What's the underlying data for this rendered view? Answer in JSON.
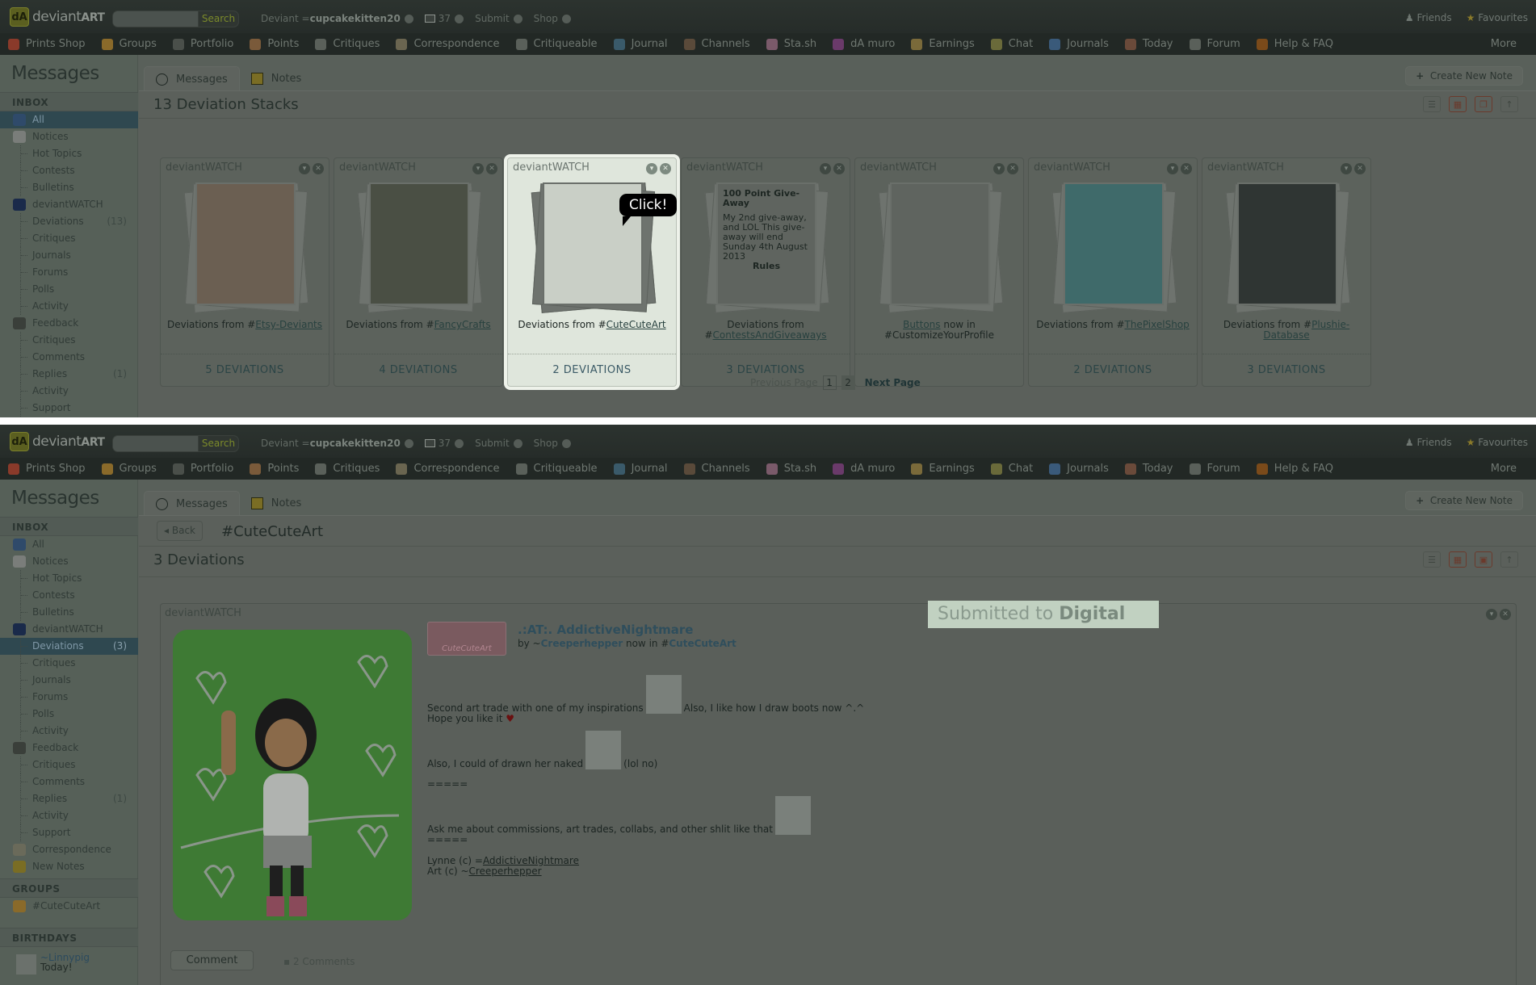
{
  "header": {
    "logo_text": "deviant",
    "logo_bold": "ART",
    "search_placeholder": "",
    "search_button": "Search",
    "user_prefix": "Deviant =",
    "username": "cupcakekitten20",
    "message_count": "37",
    "submit": "Submit",
    "shop": "Shop",
    "friends": "Friends",
    "favourites": "Favourites"
  },
  "nav": {
    "items": [
      {
        "label": "Prints Shop",
        "color": "#8a3a2a"
      },
      {
        "label": "Groups",
        "color": "#8a6a2a"
      },
      {
        "label": "Portfolio",
        "color": "#4a4f4a"
      },
      {
        "label": "Points",
        "color": "#7a5a3a"
      },
      {
        "label": "Critiques",
        "color": "#5a605a"
      },
      {
        "label": "Correspondence",
        "color": "#6a6550"
      },
      {
        "label": "Critiqueable",
        "color": "#5a605a"
      },
      {
        "label": "Journal",
        "color": "#3a5a6a"
      },
      {
        "label": "Channels",
        "color": "#5a4a3a"
      },
      {
        "label": "Sta.sh",
        "color": "#7a5a6a"
      },
      {
        "label": "dA muro",
        "color": "#6a3a6a"
      },
      {
        "label": "Earnings",
        "color": "#7a6a3a"
      },
      {
        "label": "Chat",
        "color": "#6a6a3a"
      },
      {
        "label": "Journals",
        "color": "#3a5a7a"
      },
      {
        "label": "Today",
        "color": "#6a4a3a"
      },
      {
        "label": "Forum",
        "color": "#5a605a"
      },
      {
        "label": "Help & FAQ",
        "color": "#7a4a1a"
      }
    ],
    "more": "More"
  },
  "sidebar": {
    "title": "Messages",
    "inbox_label": "INBOX",
    "groups_label": "GROUPS",
    "birthdays_label": "BIRTHDAYS",
    "screen1_items": [
      {
        "label": "All",
        "type": "top",
        "icon": "mailbox-icon",
        "active": true
      },
      {
        "label": "Notices",
        "type": "top",
        "icon": "notice-icon"
      },
      {
        "label": "Hot Topics",
        "type": "sub"
      },
      {
        "label": "Contests",
        "type": "sub"
      },
      {
        "label": "Bulletins",
        "type": "sub"
      },
      {
        "label": "deviantWATCH",
        "type": "top",
        "icon": "binoculars-icon"
      },
      {
        "label": "Deviations",
        "type": "sub",
        "count": "(13)"
      },
      {
        "label": "Critiques",
        "type": "sub"
      },
      {
        "label": "Journals",
        "type": "sub"
      },
      {
        "label": "Forums",
        "type": "sub"
      },
      {
        "label": "Polls",
        "type": "sub"
      },
      {
        "label": "Activity",
        "type": "sub"
      },
      {
        "label": "Feedback",
        "type": "top",
        "icon": "speech-bubble-icon"
      },
      {
        "label": "Critiques",
        "type": "sub"
      },
      {
        "label": "Comments",
        "type": "sub"
      },
      {
        "label": "Replies",
        "type": "sub",
        "count": "(1)"
      },
      {
        "label": "Activity",
        "type": "sub"
      },
      {
        "label": "Support",
        "type": "sub"
      }
    ],
    "screen2_items": [
      {
        "label": "All",
        "type": "top",
        "icon": "mailbox-icon"
      },
      {
        "label": "Notices",
        "type": "top",
        "icon": "notice-icon"
      },
      {
        "label": "Hot Topics",
        "type": "sub"
      },
      {
        "label": "Contests",
        "type": "sub"
      },
      {
        "label": "Bulletins",
        "type": "sub"
      },
      {
        "label": "deviantWATCH",
        "type": "top",
        "icon": "binoculars-icon"
      },
      {
        "label": "Deviations",
        "type": "sub",
        "count": "(3)",
        "active": true
      },
      {
        "label": "Critiques",
        "type": "sub"
      },
      {
        "label": "Journals",
        "type": "sub"
      },
      {
        "label": "Forums",
        "type": "sub"
      },
      {
        "label": "Polls",
        "type": "sub"
      },
      {
        "label": "Activity",
        "type": "sub"
      },
      {
        "label": "Feedback",
        "type": "top",
        "icon": "speech-bubble-icon"
      },
      {
        "label": "Critiques",
        "type": "sub"
      },
      {
        "label": "Comments",
        "type": "sub"
      },
      {
        "label": "Replies",
        "type": "sub",
        "count": "(1)"
      },
      {
        "label": "Activity",
        "type": "sub"
      },
      {
        "label": "Support",
        "type": "sub"
      },
      {
        "label": "Correspondence",
        "type": "top",
        "icon": "envelope-icon"
      },
      {
        "label": "New Notes",
        "type": "top",
        "icon": "note-icon"
      }
    ],
    "groups": [
      {
        "label": "#CuteCuteArt",
        "icon": "house-icon"
      }
    ],
    "birthdays": [
      {
        "name": "~Linnypig",
        "when": "Today!"
      }
    ]
  },
  "tabs": {
    "messages": "Messages",
    "notes": "Notes",
    "create_note": "Create New Note"
  },
  "stacks": {
    "title": "13 Deviation Stacks",
    "cards": [
      {
        "header": "deviantWATCH",
        "prefix": "Deviations from #",
        "link": "Etsy-Deviants",
        "suffix": "",
        "count": "5 DEVIATIONS",
        "color": "#6b5f52"
      },
      {
        "header": "deviantWATCH",
        "prefix": "Deviations from #",
        "link": "FancyCrafts",
        "suffix": "",
        "count": "4 DEVIATIONS",
        "color": "#4a4f44"
      },
      {
        "header": "deviantWATCH",
        "prefix": "Deviations from #",
        "link": "CuteCuteArt",
        "suffix": "",
        "count": "2 DEVIATIONS",
        "color": "#c9cfc6",
        "highlight": true
      },
      {
        "header": "deviantWATCH",
        "prefix": "Deviations from #",
        "link": "ContestsAndGiveaways",
        "suffix": "",
        "count": "3 DEVIATIONS",
        "color": "#5f645f",
        "journal": {
          "title": "100 Point Give-Away",
          "text": "My 2nd give-away, and LOL This give-away will end Sunday 4th August 2013",
          "footer": "Rules"
        }
      },
      {
        "header": "deviantWATCH",
        "prefix": "",
        "link": "Buttons",
        "suffix": " now in #CustomizeYourProfile",
        "count": "",
        "color": "#5f645f"
      },
      {
        "header": "deviantWATCH",
        "prefix": "Deviations from #",
        "link": "ThePixelShop",
        "suffix": "",
        "count": "2 DEVIATIONS",
        "color": "#3f6a6a"
      },
      {
        "header": "deviantWATCH",
        "prefix": "Deviations from #",
        "link": "Plushie-Database",
        "suffix": "",
        "count": "3 DEVIATIONS",
        "color": "#2f3533"
      }
    ],
    "tooltip": "Click!",
    "pager": {
      "prev": "Previous Page",
      "pages": [
        "1",
        "2"
      ],
      "current": "2",
      "next": "Next Page"
    }
  },
  "detail": {
    "back": "Back",
    "group_title": "#CuteCuteArt",
    "count_title": "3 Deviations",
    "card_header": "deviantWATCH",
    "submitted_prefix": "Submitted to ",
    "submitted_category": "Digital",
    "badge": "CuteCuteArt",
    "dev_title": ".:AT:. AddictiveNightmare",
    "by_prefix": "by ~",
    "by_user": "Creeperhepper",
    "now_in": " now in #",
    "now_in_group": "CuteCuteArt",
    "body": {
      "line1": "Second art trade with one of my inspirations",
      "line1b": "Also, I like how I draw boots now ^.^",
      "line2": "Hope you like it",
      "line3": "Also, I could of drawn her naked",
      "line3b": "(lol no)",
      "sep": "=====",
      "line4": "Ask me about commissions, art trades, collabs, and other shlit like that",
      "credit1_prefix": "Lynne (c) =",
      "credit1_link": "AddictiveNightmare",
      "credit2_prefix": "Art (c) ~",
      "credit2_link": "Creeperhepper"
    },
    "comment_button": "Comment",
    "comments_count": "2 Comments"
  }
}
